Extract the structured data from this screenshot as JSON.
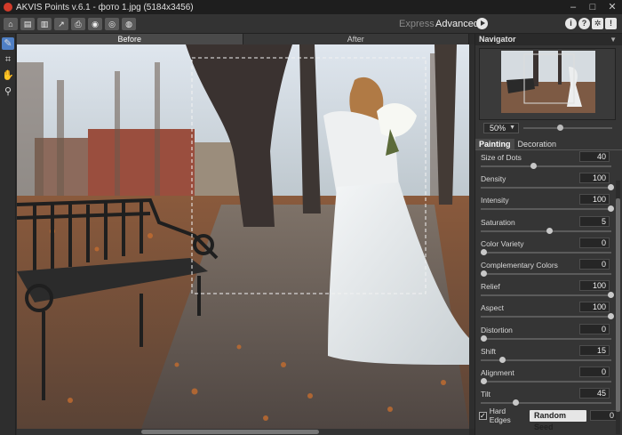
{
  "window": {
    "title": "AKVIS Points v.6.1 - фото 1.jpg (5184x3456)"
  },
  "toolbar": {
    "modes": {
      "express": "Express",
      "advanced": "Advanced"
    }
  },
  "view_tabs": {
    "before": "Before",
    "after": "After"
  },
  "navigator": {
    "title": "Navigator",
    "zoom": "50%"
  },
  "settings_tabs": {
    "painting": "Painting",
    "decoration": "Decoration"
  },
  "params": [
    {
      "label": "Size of Dots",
      "value": "40",
      "level": 0.39
    },
    {
      "label": "Density",
      "value": "100",
      "level": 1.0
    },
    {
      "label": "Intensity",
      "value": "100",
      "level": 1.0
    },
    {
      "label": "Saturation",
      "value": "5",
      "level": 0.52
    },
    {
      "label": "Color Variety",
      "value": "0",
      "level": 0.0
    },
    {
      "label": "Complementary Colors",
      "value": "0",
      "level": 0.0
    },
    {
      "label": "Relief",
      "value": "100",
      "level": 1.0
    },
    {
      "label": "Aspect",
      "value": "100",
      "level": 1.0
    },
    {
      "label": "Distortion",
      "value": "0",
      "level": 0.0
    },
    {
      "label": "Shift",
      "value": "15",
      "level": 0.15
    },
    {
      "label": "Alignment",
      "value": "0",
      "level": 0.0
    },
    {
      "label": "Tilt",
      "value": "45",
      "level": 0.25
    }
  ],
  "hard_edges": {
    "label": "Hard Edges",
    "checked": true
  },
  "random_seed": {
    "label": "Random Seed",
    "value": "0"
  }
}
